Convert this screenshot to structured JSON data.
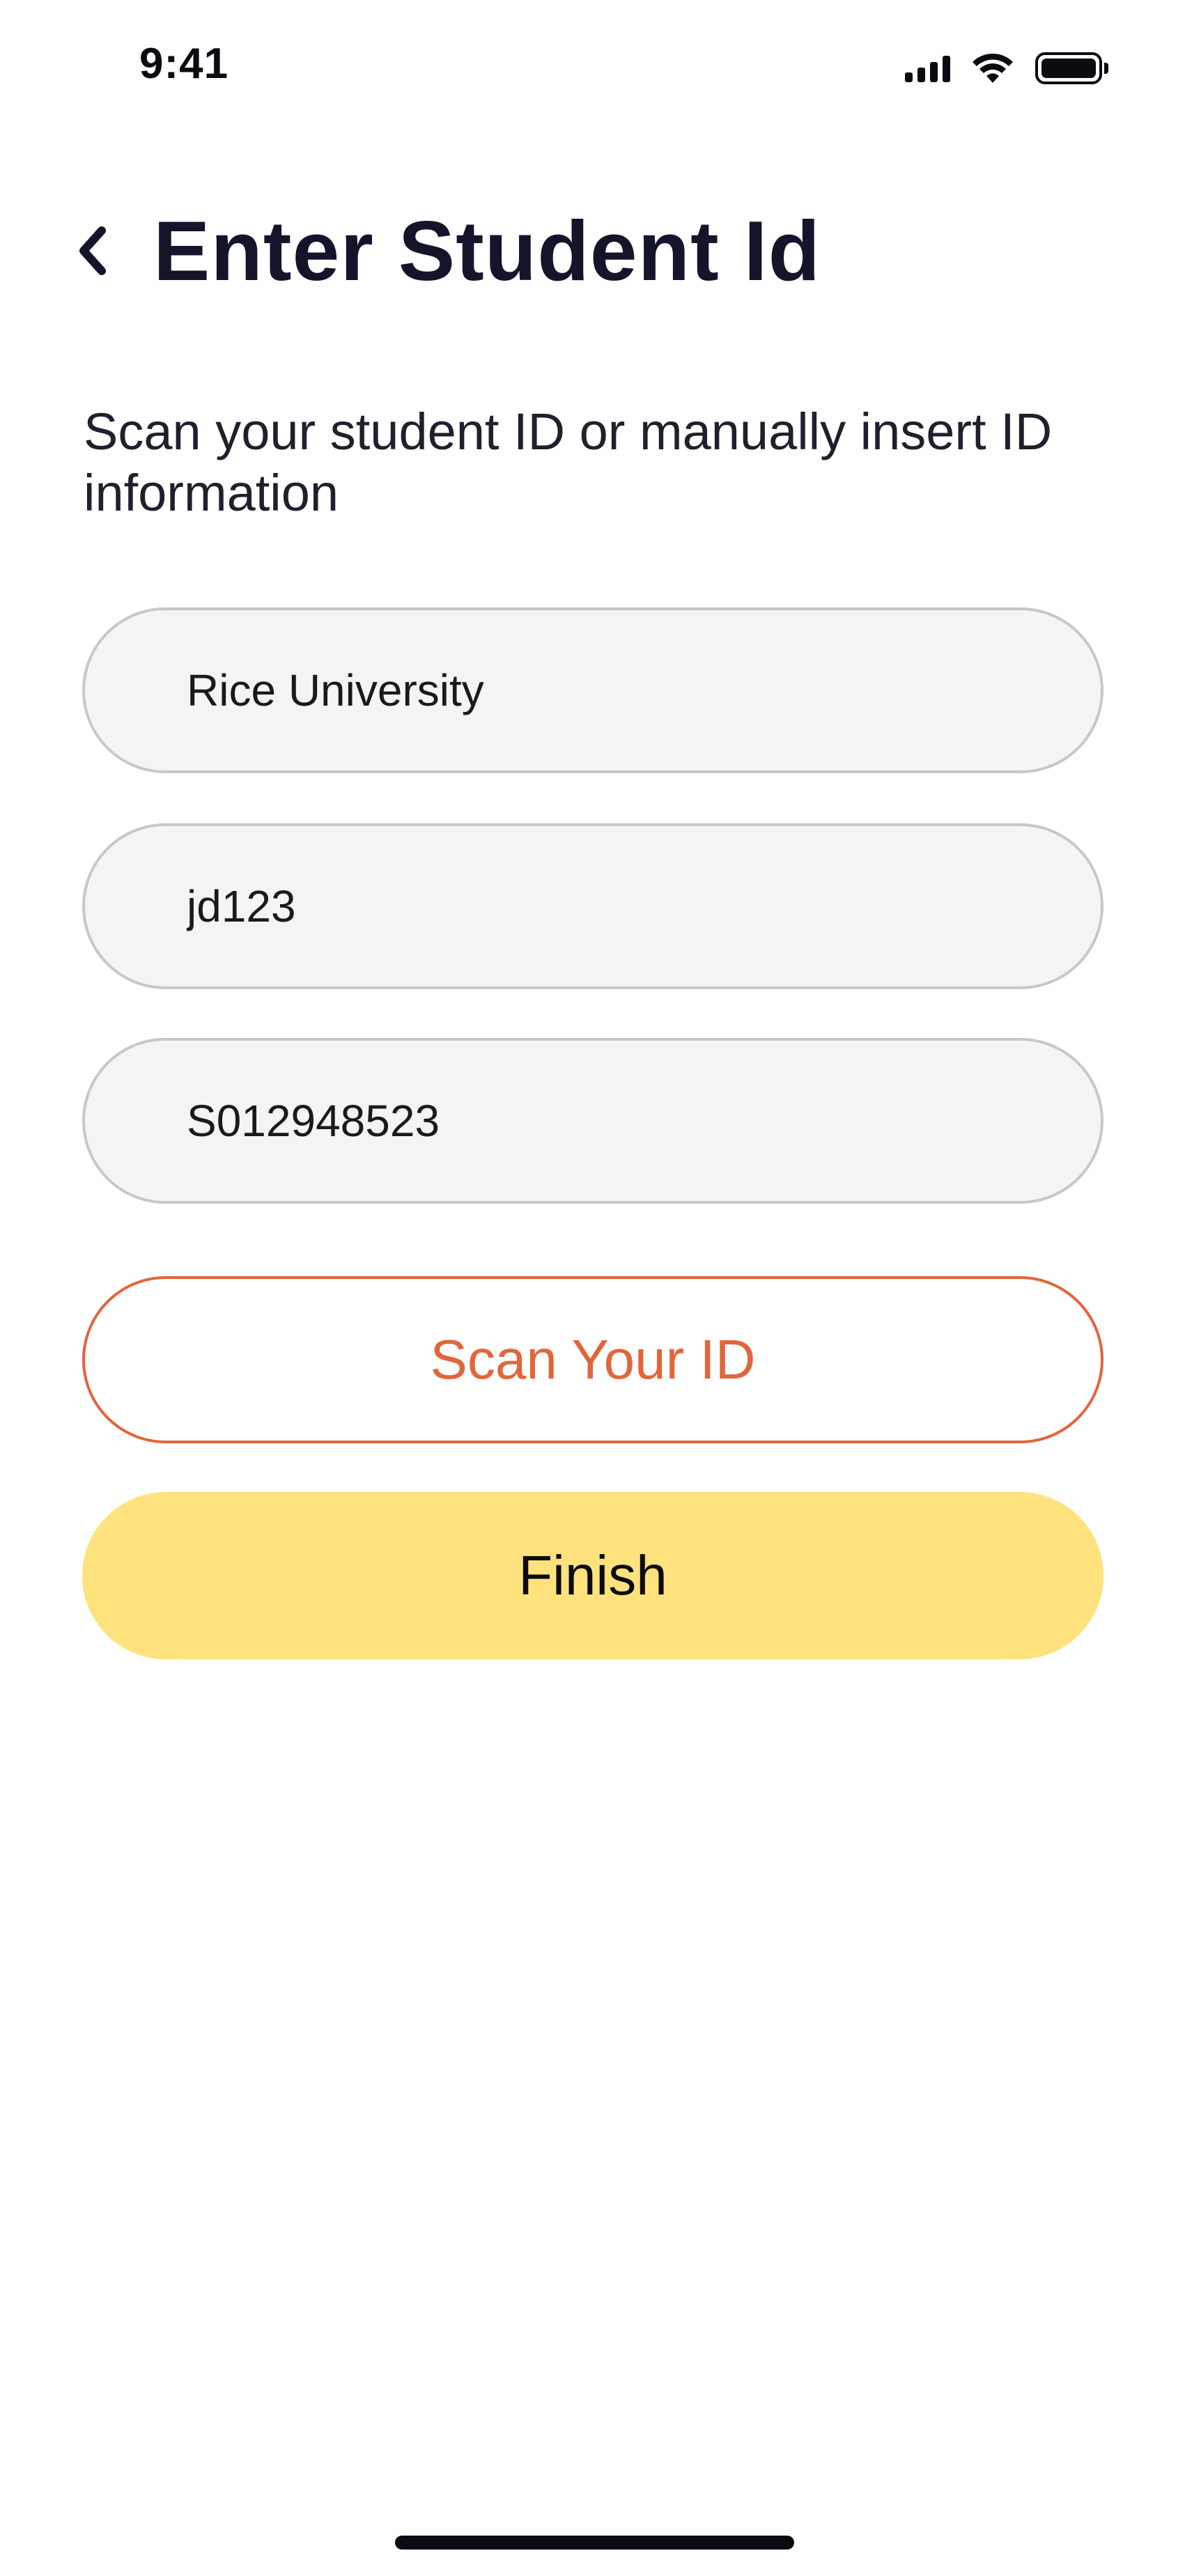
{
  "status_bar": {
    "time": "9:41"
  },
  "header": {
    "title": "Enter Student Id"
  },
  "description": "Scan your student ID or manually insert ID information",
  "form": {
    "school": {
      "value": "Rice University"
    },
    "net_id": {
      "value": "jd123"
    },
    "student_id": {
      "value": "S012948523"
    }
  },
  "buttons": {
    "scan_label": "Scan Your ID",
    "finish_label": "Finish"
  },
  "colors": {
    "accent_orange": "#e2653a",
    "finish_yellow": "#ffe27d",
    "field_bg": "#f4f4f4",
    "field_border": "#c7c7c7",
    "title_text": "#14142b"
  },
  "icons": {
    "back": "chevron-left-icon",
    "signal": "cellular-signal-icon",
    "wifi": "wifi-icon",
    "battery": "battery-icon"
  }
}
